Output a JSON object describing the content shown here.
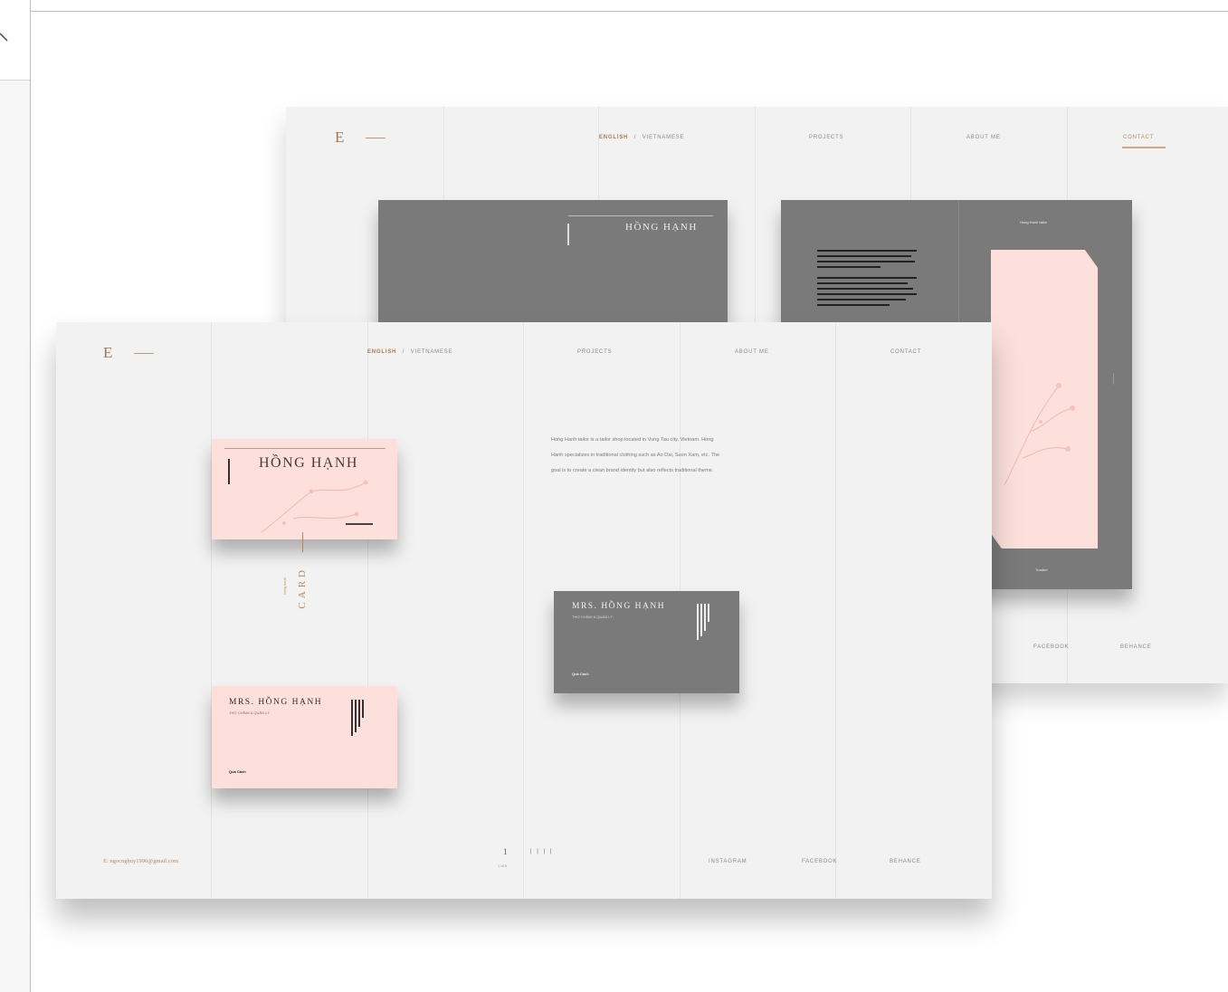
{
  "nav": {
    "logo": "E",
    "lang_english": "ENGLISH",
    "lang_sep": "/",
    "lang_vietnamese": "VIETNAMESE",
    "projects": "PROJECTS",
    "about_me": "ABOUT ME",
    "contact": "CONTACT"
  },
  "back_page": {
    "card_title": "HỒNG HẠNH",
    "panel_heading": "Hong Hanh tailor",
    "panel_caption": "Trusted",
    "facebook": "FACEBOOK",
    "behance": "BEHANCE"
  },
  "front_page": {
    "card1_title": "HỒNG HẠNH",
    "vertical_label": "CARD",
    "vertical_sublabel": "hong hanh",
    "card2_title": "MRS. HỒNG HẠNH",
    "card2_sub": "THỢ CHÍNH & QUẢN LÝ",
    "card2_footer": "Quá Cách",
    "dark_card_title": "MRS. HỒNG HẠNH",
    "dark_card_sub": "THỢ CHÍNH & QUẢN LÝ",
    "dark_card_footer": "Quá Cách",
    "description": "Hong Hanh tailor is a tailor shop located in Vung Tau city, Vietnam. Hong Hanh specializes in traditional clothing such as Ao Dai, Suon Xam, etc. The goal is to create a clean brand identity but also reflects traditional theme.",
    "email": "E: ngocnghuy1996@gmail.com",
    "page_number": "1",
    "page_total": "1 of 5",
    "page_marks": "| | | |",
    "instagram": "INSTAGRAM",
    "facebook": "FACEBOOK",
    "behance": "BEHANCE"
  },
  "colors": {
    "page_bg": "#f2f2f2",
    "pink_card": "#fde0dc",
    "grey_card": "#7a7a7a",
    "accent": "#b08a66"
  }
}
